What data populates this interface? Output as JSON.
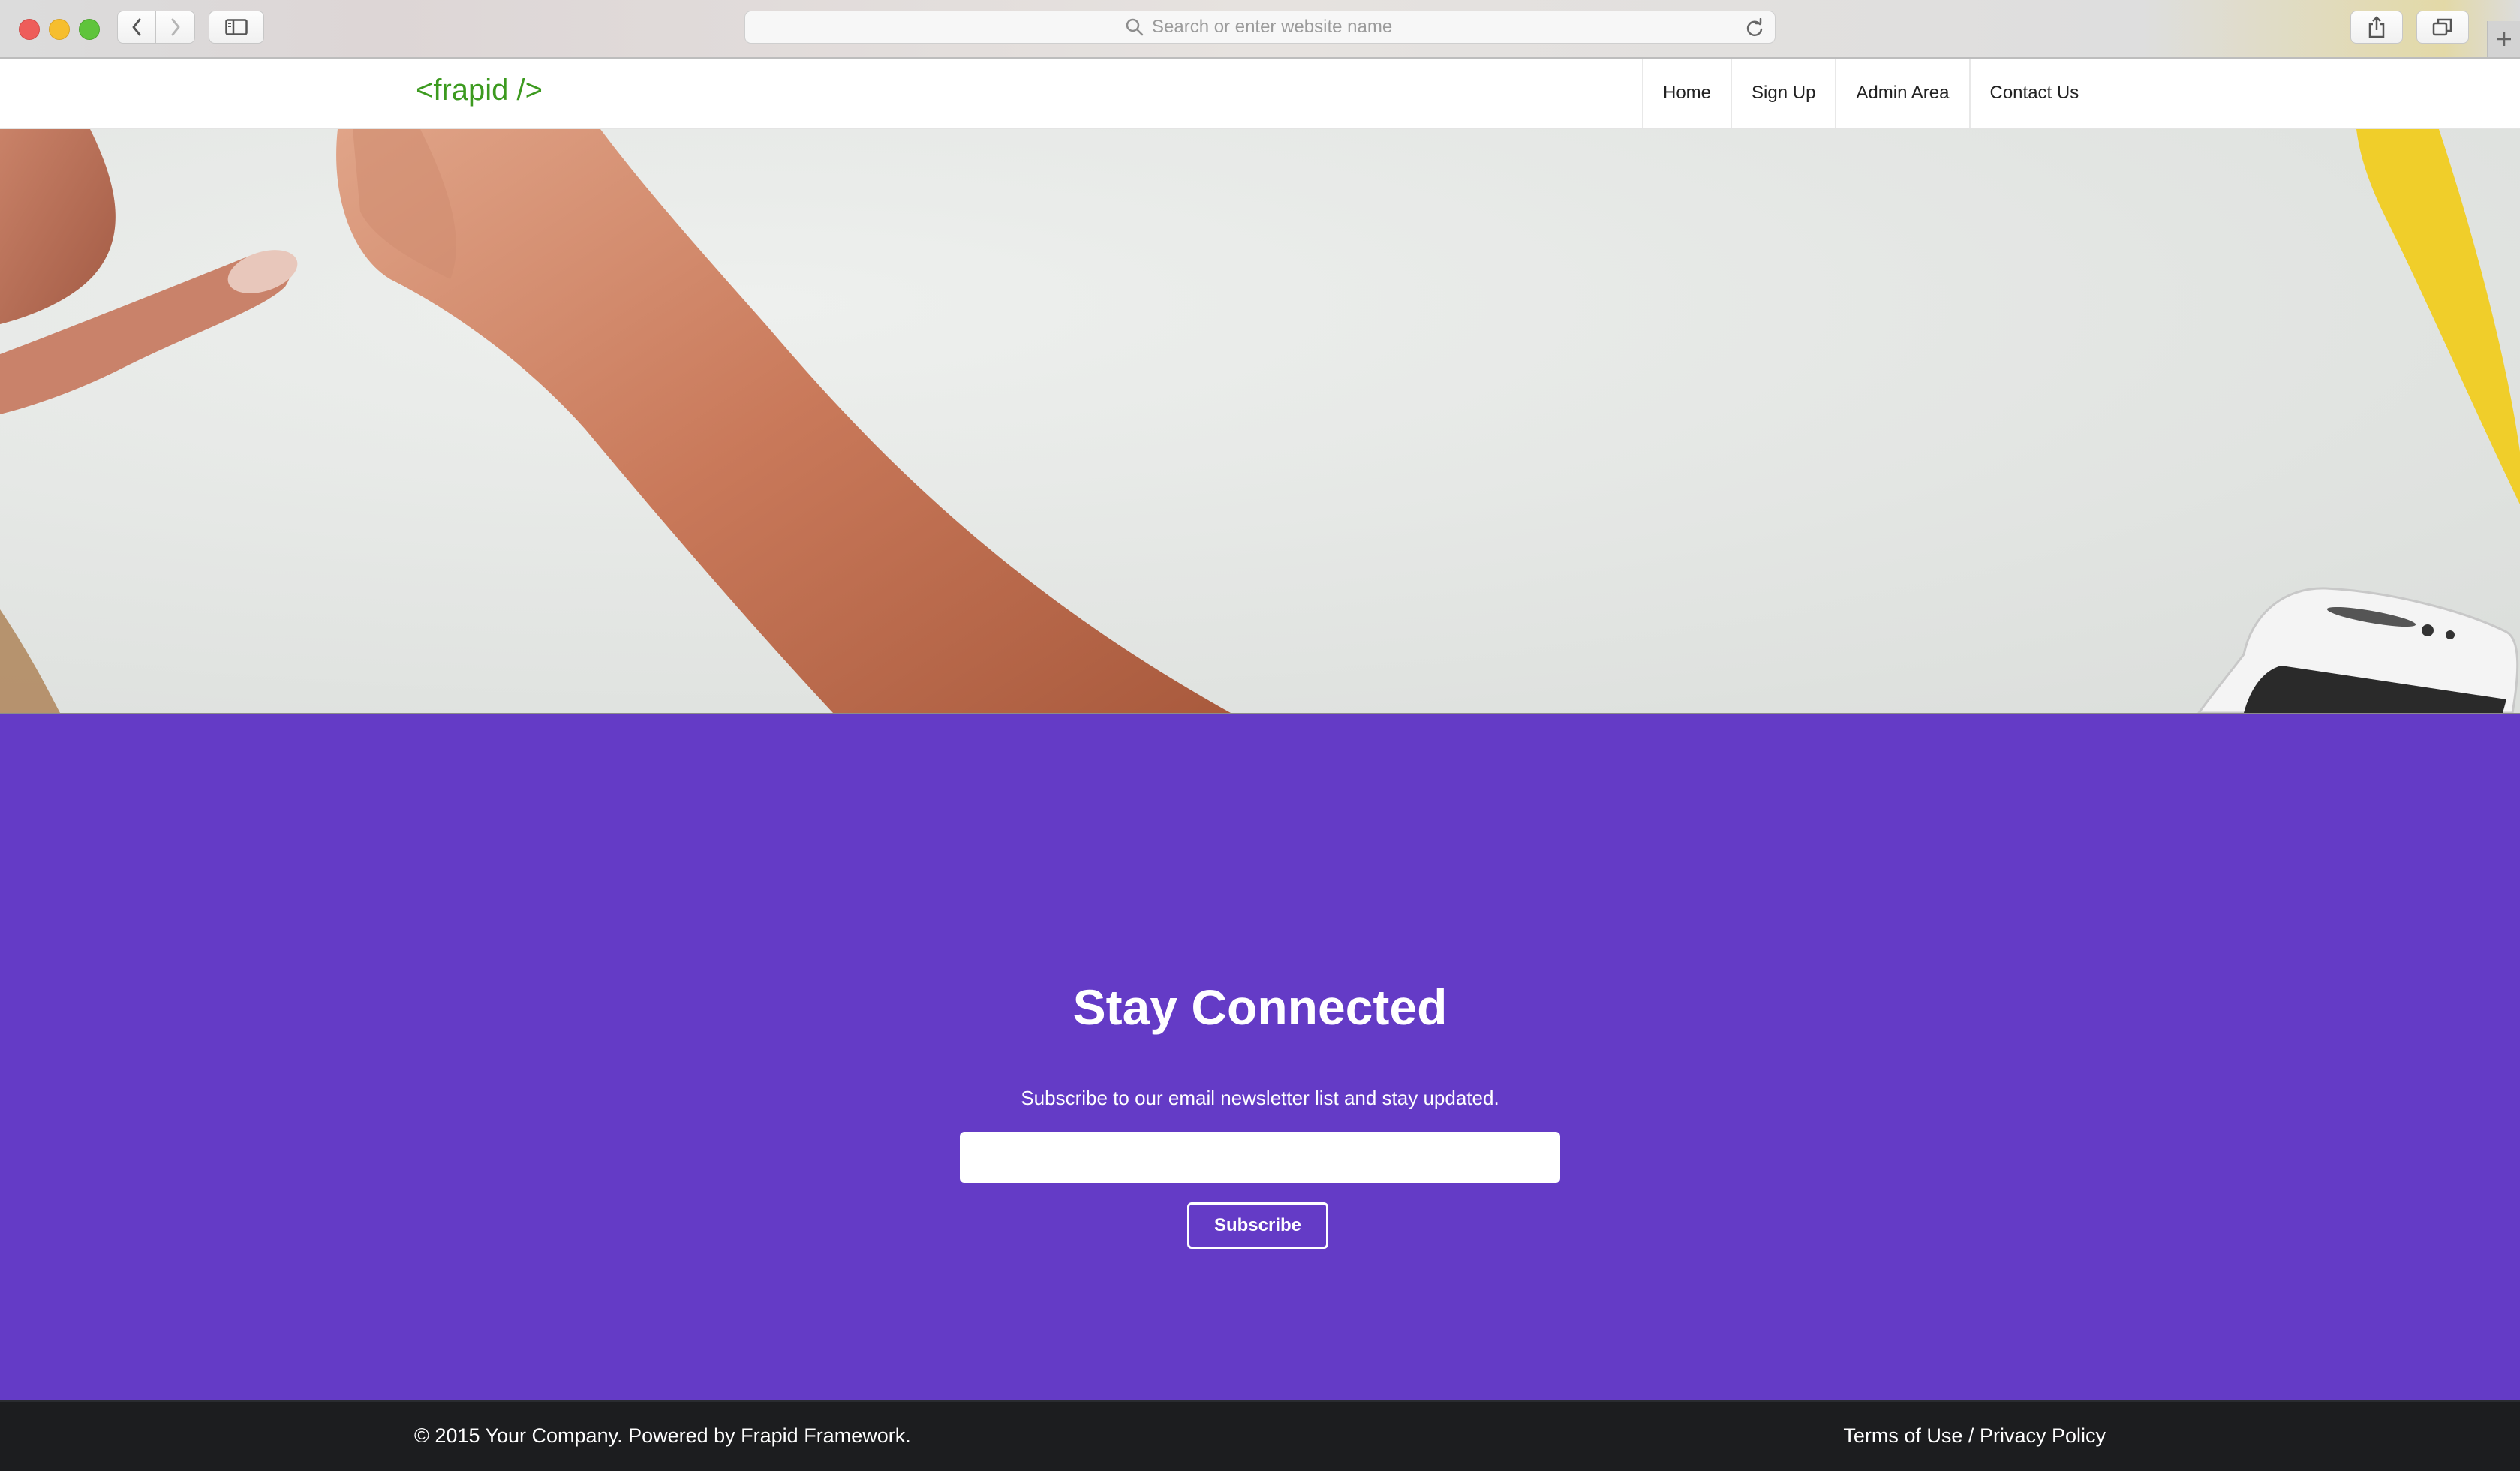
{
  "browser": {
    "address_placeholder": "Search or enter website name"
  },
  "navbar": {
    "brand": "<frapid />",
    "items": [
      {
        "label": "Home"
      },
      {
        "label": "Sign Up"
      },
      {
        "label": "Admin Area"
      },
      {
        "label": "Contact Us"
      }
    ]
  },
  "newsletter": {
    "title": "Stay Connected",
    "subtitle": "Subscribe to our email newsletter list and stay updated.",
    "email_value": "",
    "button_label": "Subscribe",
    "background_color": "#643bc6"
  },
  "footer": {
    "copyright": "© 2015 Your Company. Powered by Frapid Framework.",
    "terms": "Terms of Use",
    "separator": "/",
    "privacy": "Privacy Policy"
  },
  "icons": [
    "back-arrow-icon",
    "forward-arrow-icon",
    "sidebar-icon",
    "search-icon",
    "reload-icon",
    "share-icon",
    "tabs-icon",
    "plus-icon"
  ],
  "colors": {
    "brand": "#3c9a1f",
    "footer_bg": "#1c1d1f"
  }
}
